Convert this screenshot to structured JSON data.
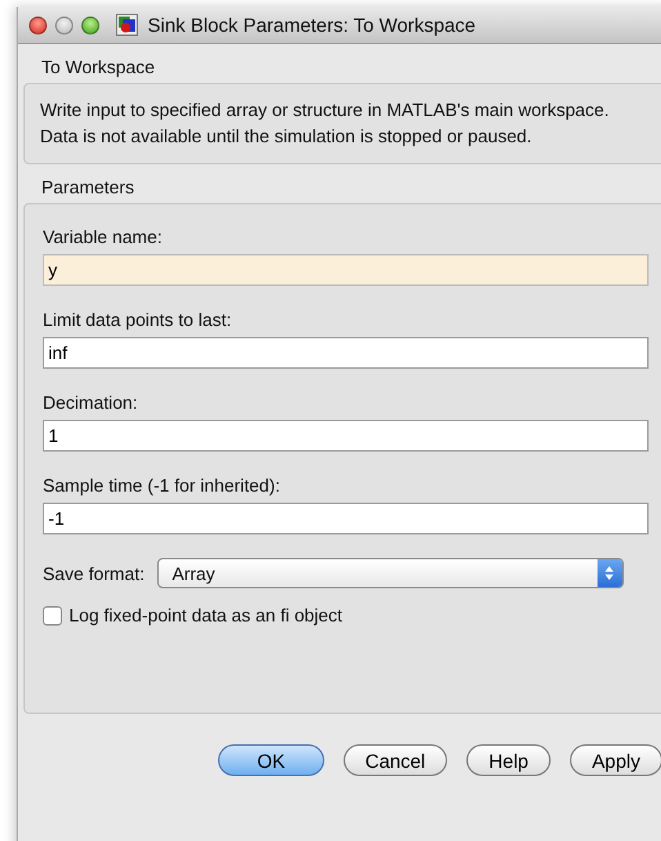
{
  "window": {
    "title": "Sink Block Parameters: To Workspace"
  },
  "block": {
    "name": "To Workspace",
    "description": "Write input to specified array or structure in MATLAB's main workspace. Data is not available until the simulation is stopped or paused."
  },
  "parameters": {
    "title": "Parameters",
    "fields": [
      {
        "kind": "text",
        "label": "Variable name:",
        "value": "y",
        "focused": true
      },
      {
        "kind": "text",
        "label": "Limit data points to last:",
        "value": "inf",
        "focused": false
      },
      {
        "kind": "text",
        "label": "Decimation:",
        "value": "1",
        "focused": false
      },
      {
        "kind": "text",
        "label": "Sample time (-1 for inherited):",
        "value": "-1",
        "focused": false
      },
      {
        "kind": "select",
        "label": "Save format:",
        "value": "Array",
        "focused": false
      },
      {
        "kind": "checkbox",
        "label": "Log fixed-point data as an fi object",
        "checked": false
      }
    ]
  },
  "buttons": [
    {
      "label": "OK",
      "default": true
    },
    {
      "label": "Cancel",
      "default": false
    },
    {
      "label": "Help",
      "default": false
    },
    {
      "label": "Apply",
      "default": false
    }
  ]
}
